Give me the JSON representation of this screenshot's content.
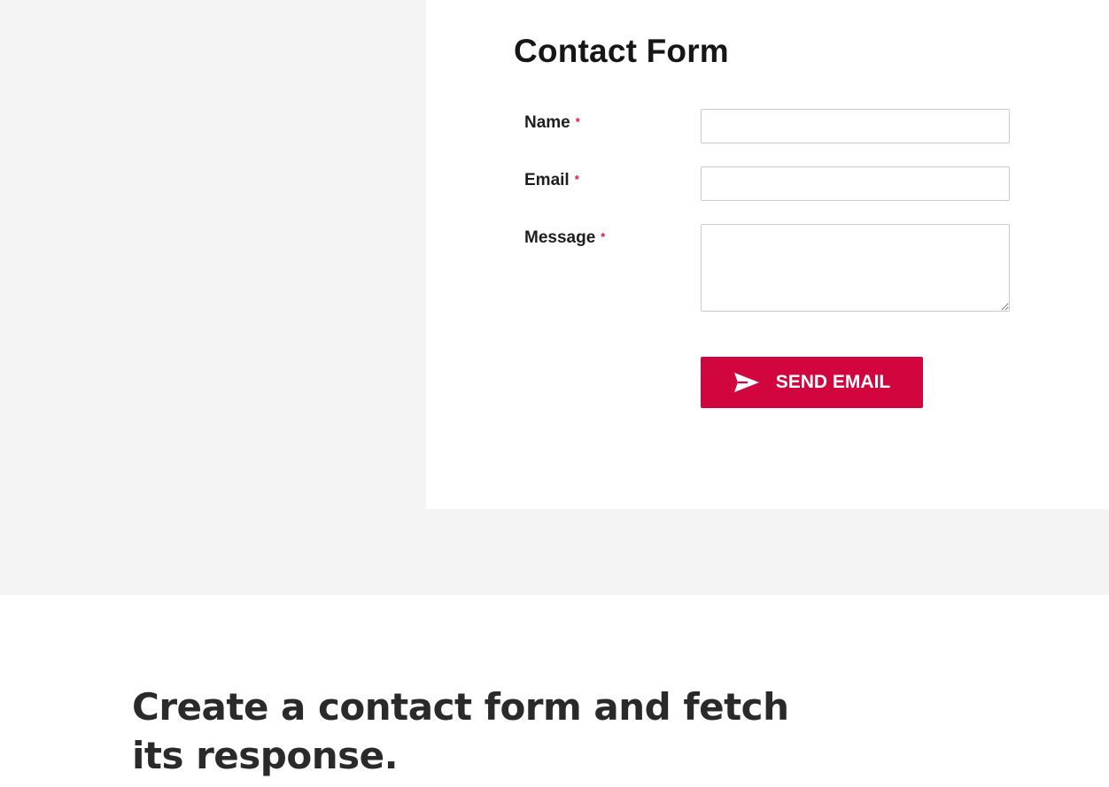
{
  "contact_form": {
    "title": "Contact Form",
    "required_marker": "*",
    "fields": {
      "name": {
        "label": "Name",
        "value": ""
      },
      "email": {
        "label": "Email",
        "value": ""
      },
      "message": {
        "label": "Message",
        "value": ""
      }
    },
    "submit": {
      "label": "SEND EMAIL",
      "icon": "paper-plane-icon"
    }
  },
  "article": {
    "heading": "Create a contact form and fetch its response."
  },
  "colors": {
    "accent": "#d1063f",
    "page_background": "#f4f4f4",
    "panel_background": "#ffffff"
  }
}
